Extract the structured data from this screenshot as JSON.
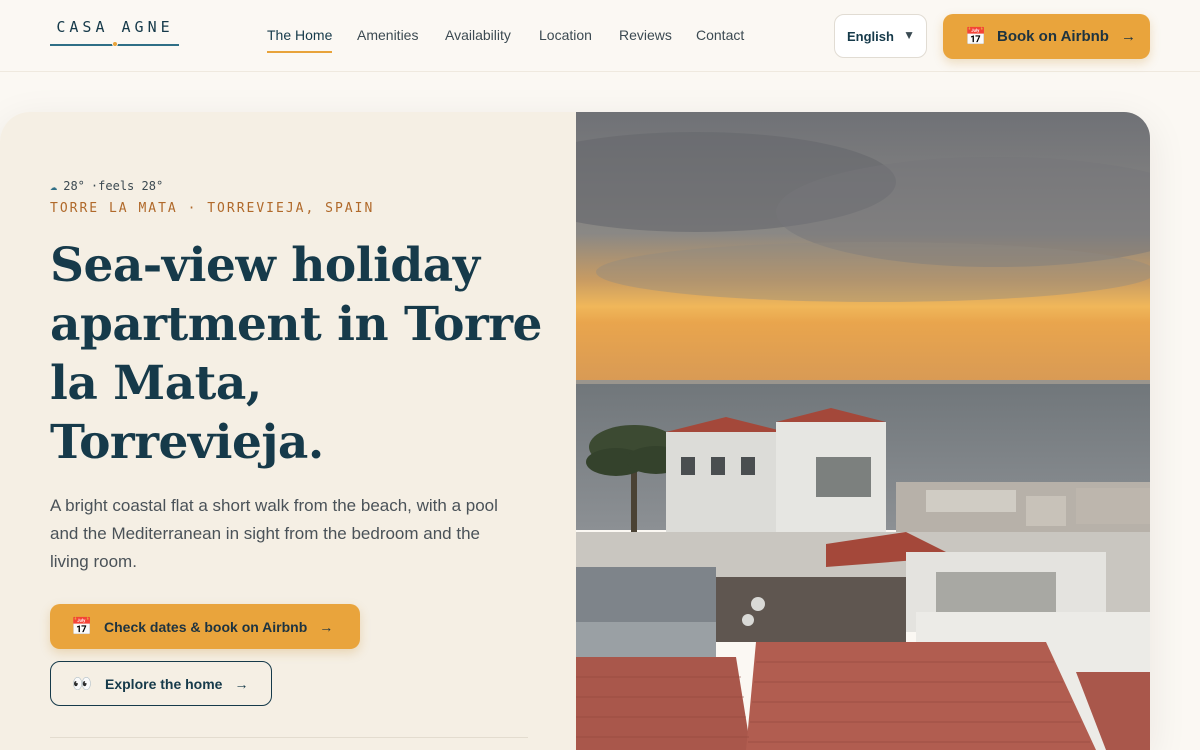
{
  "brand": {
    "name": "CASA AGNE"
  },
  "nav": {
    "items": [
      {
        "label": "The Home",
        "active": true
      },
      {
        "label": "Amenities"
      },
      {
        "label": "Availability"
      },
      {
        "label": "Location"
      },
      {
        "label": "Reviews"
      },
      {
        "label": "Contact"
      }
    ]
  },
  "language": {
    "selected": "English",
    "arrow": "▼"
  },
  "header_cta": {
    "icon": "calendar-icon",
    "label": "Book on Airbnb",
    "arrow": "→"
  },
  "hero": {
    "weather": {
      "icon": "cloud-icon",
      "temp": "28°",
      "feels": "·feels 28°"
    },
    "location": "TORRE LA MATA · TORREVIEJA, SPAIN",
    "title": "Sea-view holiday apartment in Torre la Mata, Torrevieja.",
    "description": "A bright coastal flat a short walk from the beach, with a pool and the Mediterranean in sight from the bedroom and the living room.",
    "primary_cta": {
      "icon": "calendar-icon",
      "label": "Check dates & book on Airbnb",
      "arrow": "→"
    },
    "secondary_cta": {
      "icon": "eyes-icon",
      "label": "Explore the home",
      "arrow": "→"
    }
  },
  "colors": {
    "accent": "#e9a43c",
    "navy": "#163a4a",
    "panel": "#f5efe4",
    "location_text": "#b0692a"
  }
}
